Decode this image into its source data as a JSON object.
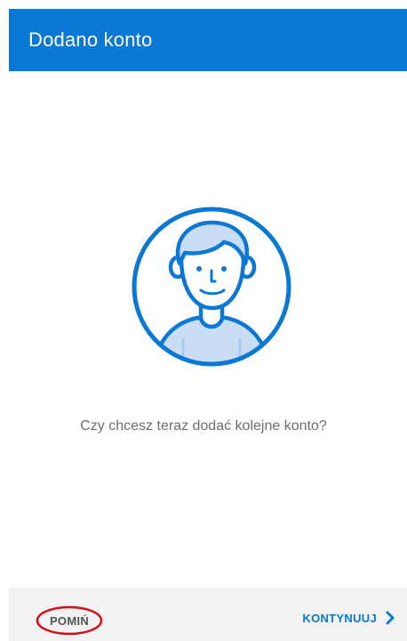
{
  "header": {
    "title": "Dodano konto"
  },
  "main": {
    "illustration_icon": "person-avatar-icon",
    "prompt": "Czy chcesz teraz dodać kolejne konto?"
  },
  "footer": {
    "skip_label": "POMIŃ",
    "continue_label": "KONTYNUUJ",
    "continue_icon": "chevron-right-icon"
  },
  "colors": {
    "accent": "#0a78d4",
    "avatar_fill": "#c9def5",
    "highlight_circle": "#d0101c",
    "footer_background": "#f2f2f2"
  }
}
